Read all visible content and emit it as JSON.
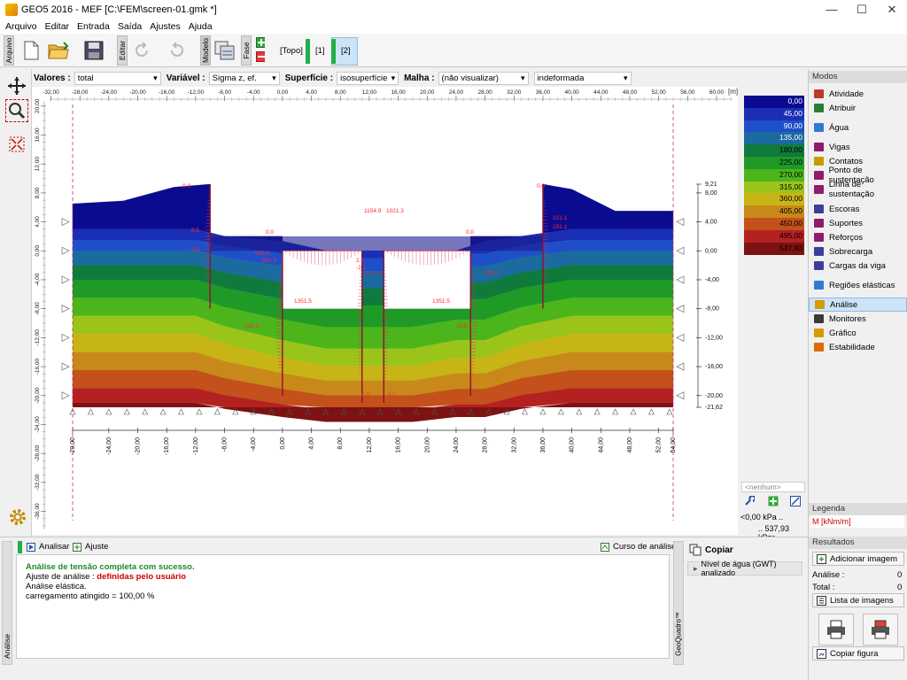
{
  "window": {
    "title": "GEO5 2016 - MEF [C:\\FEM\\screen-01.gmk *]",
    "minimize": "—",
    "maximize": "☐",
    "close": "✕"
  },
  "menu": [
    "Arquivo",
    "Editar",
    "Entrada",
    "Saída",
    "Ajustes",
    "Ajuda"
  ],
  "toolbar": {
    "arquivo_tab": "Arquivo",
    "editar_tab": "Editar",
    "modelo_tab": "Modelo",
    "fase_tab": "Fase",
    "stage_topo": "[Topo]",
    "stage_1": "[1]",
    "stage_2": "[2]"
  },
  "filters": {
    "valores_label": "Valores :",
    "valores_value": "total",
    "variavel_label": "Variável :",
    "variavel_value": "Sigma z, ef.",
    "superficie_label": "Superfície :",
    "superficie_value": "isosuperfície",
    "malha_label": "Malha :",
    "malha_value": "(não visualizar)",
    "deform_value": "indeformada"
  },
  "canvas": {
    "unit_label": "[m]",
    "x_ticks": [
      "-32,00",
      "-28,00",
      "-24,00",
      "-20,00",
      "-16,00",
      "-12,00",
      "-8,00",
      "-4,00",
      "0,00",
      "4,00",
      "8,00",
      "12,00",
      "16,00",
      "20,00",
      "24,00",
      "28,00",
      "32,00",
      "36,00",
      "40,00",
      "44,00",
      "48,00",
      "52,00",
      "56,00",
      "60,00"
    ],
    "y_ticks": [
      "20,00",
      "16,00",
      "12,00",
      "8,00",
      "4,00",
      "0,00",
      "-4,00",
      "-8,00",
      "-12,00",
      "-16,00",
      "-20,00",
      "-24,00",
      "-28,00",
      "-32,00",
      "-36,00"
    ],
    "bottom_ticks": [
      "-29,00",
      "-24,00",
      "-20,00",
      "-16,00",
      "-12,00",
      "-8,00",
      "-4,00",
      "0,00",
      "4,00",
      "8,00",
      "12,00",
      "16,00",
      "20,00",
      "24,00",
      "28,00",
      "32,00",
      "36,00",
      "40,00",
      "44,00",
      "48,00",
      "52,00",
      "54,00"
    ],
    "right_ticks": [
      "9,21",
      "8,00",
      "4,00",
      "0,00",
      "-4,00",
      "-8,00",
      "-12,00",
      "-16,00",
      "-20,00",
      "-21,62"
    ],
    "labels": {
      "l00a": "0.0",
      "l00b": "0.0",
      "l00c": "0.0",
      "l00d": "0.0",
      "l00e": "0.0",
      "l00f": "0.0",
      "top_mid1": "1154.9",
      "top_mid2": "1021.3",
      "left_a": "5.5",
      "left_b": "555.2",
      "left_c": "-301.2",
      "left_d": "5.5",
      "right_a": "151.1",
      "right_b": "151.1",
      "right_c": "218.2",
      "mid_a": "-1.1",
      "mid_b": "2.2",
      "wall_a": "1351.5",
      "wall_b": "1351.5",
      "low_a": "218.2",
      "low_b": "218.2"
    }
  },
  "legend_scale": {
    "values": [
      "0,00",
      "45,00",
      "90,00",
      "135,00",
      "180,00",
      "225,00",
      "270,00",
      "315,00",
      "360,00",
      "405,00",
      "450,00",
      "495,00",
      "537,93"
    ],
    "colors": [
      "#0b0b8f",
      "#1a2fb5",
      "#1e4fc9",
      "#1b6aa0",
      "#0f7a3c",
      "#1f9a27",
      "#4cb51c",
      "#9bc41a",
      "#c7b516",
      "#c9891a",
      "#c4501b",
      "#b42121",
      "#7d1212"
    ],
    "nenhum": "<nenhum>",
    "min_label": "<0,00 kPa ..",
    "max_label": ".. 537,93 kPa>"
  },
  "modes_panel": {
    "title": "Modos",
    "items": [
      {
        "label": "Atividade",
        "icon": "activity-icon",
        "color": "#c0392b"
      },
      {
        "label": "Atribuir",
        "icon": "assign-icon",
        "color": "#2e7d32"
      },
      {
        "label": "Água",
        "icon": "water-icon",
        "color": "#2f7bd3"
      },
      {
        "label": "Vigas",
        "icon": "beam-icon",
        "color": "#8e1b6b"
      },
      {
        "label": "Contatos",
        "icon": "contact-icon",
        "color": "#c69b00"
      },
      {
        "label": "Ponto de sustentação",
        "icon": "point-support-icon",
        "color": "#8e1b6b"
      },
      {
        "label": "Linha de sustentação",
        "icon": "line-support-icon",
        "color": "#8e1b6b"
      },
      {
        "label": "Escoras",
        "icon": "strut-icon",
        "color": "#3e3e9a"
      },
      {
        "label": "Suportes",
        "icon": "support-icon",
        "color": "#8e1b6b"
      },
      {
        "label": "Reforços",
        "icon": "reinforcement-icon",
        "color": "#8e1b6b"
      },
      {
        "label": "Sobrecarga",
        "icon": "surcharge-icon",
        "color": "#3e3e9a"
      },
      {
        "label": "Cargas da viga",
        "icon": "beam-load-icon",
        "color": "#3e3e9a"
      },
      {
        "label": "Regiões elásticas",
        "icon": "elastic-region-icon",
        "color": "#2f7bd3"
      },
      {
        "label": "Análise",
        "icon": "analysis-icon",
        "color": "#d99a00"
      },
      {
        "label": "Monitores",
        "icon": "monitor-icon",
        "color": "#3a3a3a"
      },
      {
        "label": "Gráfico",
        "icon": "graph-icon",
        "color": "#d99a00"
      },
      {
        "label": "Estabilidade",
        "icon": "stability-icon",
        "color": "#e06a00"
      }
    ],
    "legenda_title": "Legenda",
    "legenda_value": "M [kNm/m]",
    "resultados_title": "Resultados",
    "add_image": "Adicionar imagem",
    "analise_label": "Análise :",
    "analise_value": "0",
    "total_label": "Total :",
    "total_value": "0",
    "image_list": "Lista de imagens",
    "copy_figure": "Copiar figura"
  },
  "bottom": {
    "analisar": "Analisar",
    "ajuste": "Ajuste",
    "curso": "Curso de análise",
    "side_tab": "Análise",
    "line1": "Análise de tensão completa com sucesso.",
    "line2_prefix": "Ajuste de análise : ",
    "line2_value": "definidas pelo usuário",
    "line3": "Análise elástica.",
    "line4": "carregamento atingido = 100,00 %",
    "copiar": "Copiar",
    "gwt": "Nível de água (GWT) analizado",
    "geoquadro_tab": "GeoQuadro™"
  }
}
